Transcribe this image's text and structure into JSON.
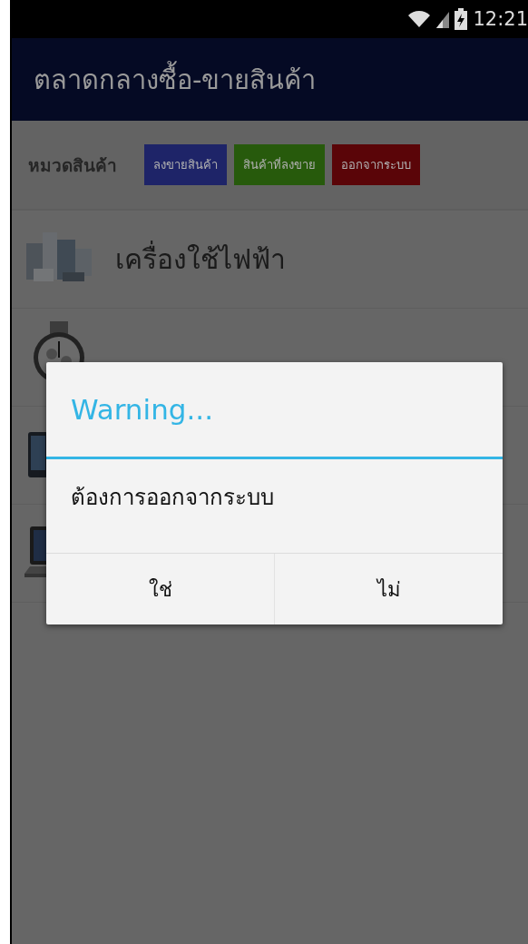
{
  "status_bar": {
    "time": "12:21"
  },
  "app_bar": {
    "title": "ตลาดกลางซื้อ-ขายสินค้า"
  },
  "toolbar": {
    "label": "หมวดสินค้า",
    "buttons": [
      {
        "label": "ลงขายสินค้า",
        "color": "#1e2468"
      },
      {
        "label": "สินค้าที่ลงขาย",
        "color": "#275a0c"
      },
      {
        "label": "ออกจากระบบ",
        "color": "#5a0508"
      }
    ]
  },
  "categories": [
    {
      "name": "เครื่องใช้ไฟฟ้า",
      "kind": "picture"
    },
    {
      "kind": "picture"
    },
    {
      "kind": "picture"
    },
    {
      "kind": "picture"
    }
  ],
  "dialog": {
    "title": "Warning...",
    "message": "ต้องการออกจากระบบ",
    "buttons": [
      "ใช่",
      "ไม่"
    ]
  }
}
